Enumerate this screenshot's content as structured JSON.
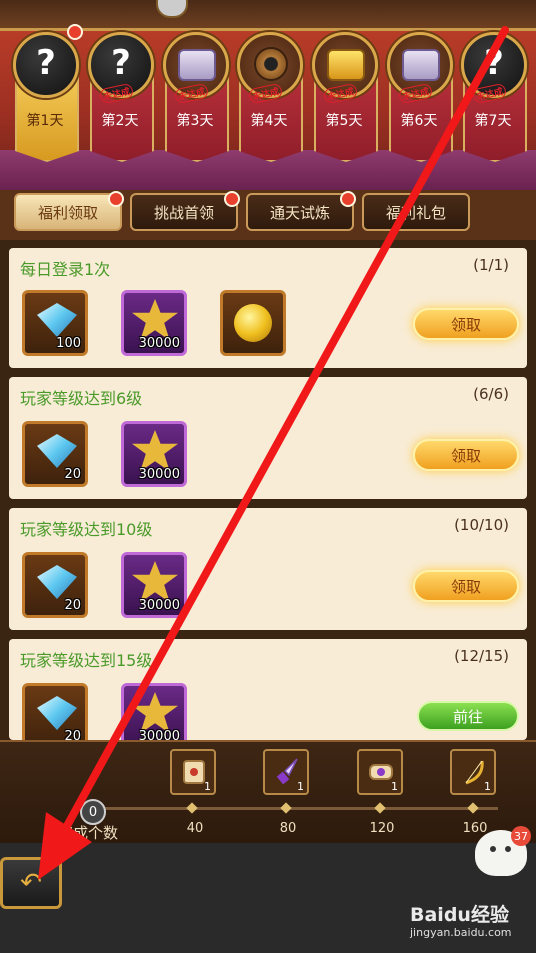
{
  "colors": {
    "accent_gold": "#f0a020",
    "task_title_green": "#4a9a2a",
    "annotation_red": "#f01818"
  },
  "days": [
    {
      "label": "第1天",
      "icon": "question-mark-medal",
      "glyph": "?",
      "stamp": ""
    },
    {
      "label": "第2天",
      "icon": "question-mark-medal",
      "glyph": "?",
      "stamp": "未达成"
    },
    {
      "label": "第3天",
      "icon": "silver-chest",
      "glyph": "",
      "stamp": "未达成"
    },
    {
      "label": "第4天",
      "icon": "bronze-medal",
      "glyph": "",
      "stamp": "未达成"
    },
    {
      "label": "第5天",
      "icon": "gold-chest",
      "glyph": "",
      "stamp": "未达成"
    },
    {
      "label": "第6天",
      "icon": "silver-chest",
      "glyph": "",
      "stamp": "未达成"
    },
    {
      "label": "第7天",
      "icon": "question-mark-medal",
      "glyph": "?",
      "stamp": "未达成"
    }
  ],
  "tabs": [
    "福利领取",
    "挑战首领",
    "通天试炼",
    "福利礼包"
  ],
  "tasks": [
    {
      "title": "每日登录1次",
      "progress": "(1/1)",
      "rewards": [
        "100",
        "30000",
        ""
      ],
      "action": "领取"
    },
    {
      "title": "玩家等级达到6级",
      "progress": "(6/6)",
      "rewards": [
        "20",
        "30000"
      ],
      "action": "领取"
    },
    {
      "title": "玩家等级达到10级",
      "progress": "(10/10)",
      "rewards": [
        "20",
        "30000"
      ],
      "action": "领取"
    },
    {
      "title": "玩家等级达到15级",
      "progress": "(12/15)",
      "rewards": [
        "20",
        "30000"
      ],
      "action": "前往"
    }
  ],
  "milestones": {
    "count": "0",
    "label": "完成个数",
    "steps": [
      {
        "value": "40",
        "icon": "scroll-icon",
        "qty": "1"
      },
      {
        "value": "80",
        "icon": "crystal-dagger-icon",
        "qty": "1"
      },
      {
        "value": "120",
        "icon": "purple-scroll-icon",
        "qty": "1"
      },
      {
        "value": "160",
        "icon": "golden-bow-icon",
        "qty": "1"
      }
    ]
  },
  "back_label": "↶",
  "notification_count": "37",
  "watermark": {
    "brand": "Baidu经验",
    "url": "jingyan.baidu.com"
  }
}
